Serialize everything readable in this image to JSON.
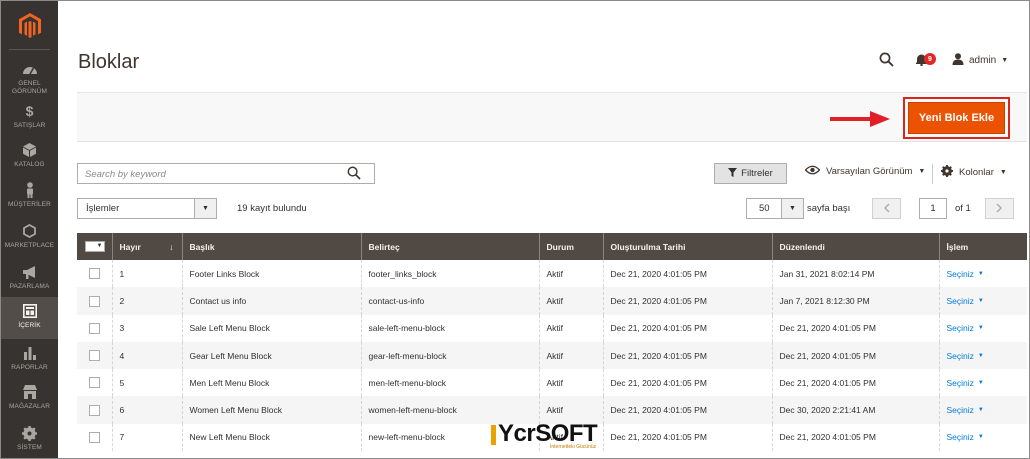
{
  "sidebar": {
    "items": [
      {
        "label": "GENEL GÖRÜNÜM",
        "icon": "dashboard-icon"
      },
      {
        "label": "SATIŞLAR",
        "icon": "dollar-icon"
      },
      {
        "label": "KATALOG",
        "icon": "cube-icon"
      },
      {
        "label": "MÜŞTERİLER",
        "icon": "person-icon"
      },
      {
        "label": "MARKETPLACE",
        "icon": "hexagon-icon"
      },
      {
        "label": "PAZARLAMA",
        "icon": "megaphone-icon"
      },
      {
        "label": "İÇERİK",
        "icon": "content-icon"
      },
      {
        "label": "RAPORLAR",
        "icon": "bar-chart-icon"
      },
      {
        "label": "MAĞAZALAR",
        "icon": "store-icon"
      },
      {
        "label": "SİSTEM",
        "icon": "gear-icon"
      }
    ],
    "active_index": 6
  },
  "header": {
    "title": "Bloklar",
    "notifications_count": "9",
    "user_name": "admin"
  },
  "action_bar": {
    "add_button_label": "Yeni Blok Ekle"
  },
  "toolbar": {
    "search_placeholder": "Search by keyword",
    "filters_label": "Filtreler",
    "view_label": "Varsayılan Görünüm",
    "columns_label": "Kolonlar",
    "actions_label": "İşlemler",
    "records_found": "19 kayıt bulundu",
    "per_page_value": "50",
    "per_page_label": "sayfa başı",
    "current_page": "1",
    "of_pages": "of 1"
  },
  "grid": {
    "columns": [
      "Hayır",
      "Başlık",
      "Belirteç",
      "Durum",
      "Oluşturulma Tarihi",
      "Düzenlendi",
      "İşlem"
    ],
    "rows": [
      {
        "id": "1",
        "title": "Footer Links Block",
        "identifier": "footer_links_block",
        "status": "Aktif",
        "created": "Dec 21, 2020 4:01:05 PM",
        "modified": "Jan 31, 2021 8:02:14 PM",
        "action": "Seçiniz"
      },
      {
        "id": "2",
        "title": "Contact us info",
        "identifier": "contact-us-info",
        "status": "Aktif",
        "created": "Dec 21, 2020 4:01:05 PM",
        "modified": "Jan 7, 2021 8:12:30 PM",
        "action": "Seçiniz"
      },
      {
        "id": "3",
        "title": "Sale Left Menu Block",
        "identifier": "sale-left-menu-block",
        "status": "Aktif",
        "created": "Dec 21, 2020 4:01:05 PM",
        "modified": "Dec 21, 2020 4:01:05 PM",
        "action": "Seçiniz"
      },
      {
        "id": "4",
        "title": "Gear Left Menu Block",
        "identifier": "gear-left-menu-block",
        "status": "Aktif",
        "created": "Dec 21, 2020 4:01:05 PM",
        "modified": "Dec 21, 2020 4:01:05 PM",
        "action": "Seçiniz"
      },
      {
        "id": "5",
        "title": "Men Left Menu Block",
        "identifier": "men-left-menu-block",
        "status": "Aktif",
        "created": "Dec 21, 2020 4:01:05 PM",
        "modified": "Dec 21, 2020 4:01:05 PM",
        "action": "Seçiniz"
      },
      {
        "id": "6",
        "title": "Women Left Menu Block",
        "identifier": "women-left-menu-block",
        "status": "Aktif",
        "created": "Dec 21, 2020 4:01:05 PM",
        "modified": "Dec 30, 2020 2:21:41 AM",
        "action": "Seçiniz"
      },
      {
        "id": "7",
        "title": "New Left Menu Block",
        "identifier": "new-left-menu-block",
        "status": "Aktif",
        "created": "Dec 21, 2020 4:01:05 PM",
        "modified": "Dec 21, 2020 4:01:05 PM",
        "action": "Seçiniz"
      }
    ]
  },
  "watermark": {
    "brand": "YcrSOFT",
    "tagline": "İnternetteki Gücünüz"
  },
  "colors": {
    "sidebar_bg": "#373330",
    "accent_orange": "#eb5202",
    "table_header_bg": "#514943",
    "link_blue": "#007bdb",
    "highlight_red": "#d9251c"
  }
}
